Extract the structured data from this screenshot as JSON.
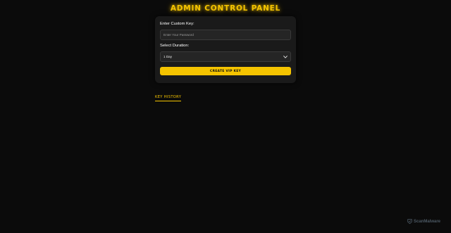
{
  "header": {
    "title": "ADMIN CONTROL PANEL"
  },
  "form": {
    "key_label": "Enter Custom Key:",
    "key_placeholder": "Enter Your Password",
    "key_value": "",
    "duration_label": "Select Duration:",
    "duration_selected": "1 Day",
    "submit_label": "CREATE VIP KEY"
  },
  "history": {
    "link_label": "KEY HISTORY"
  },
  "watermark": {
    "text": "ScanMalware"
  },
  "colors": {
    "background": "#0b0b0b",
    "card": "#1a1a1a",
    "accent": "#f5c400",
    "input_bg": "#252525"
  },
  "icons": {
    "select_arrow": "chevron-down-icon",
    "watermark_logo": "scanmalware-logo-icon"
  }
}
